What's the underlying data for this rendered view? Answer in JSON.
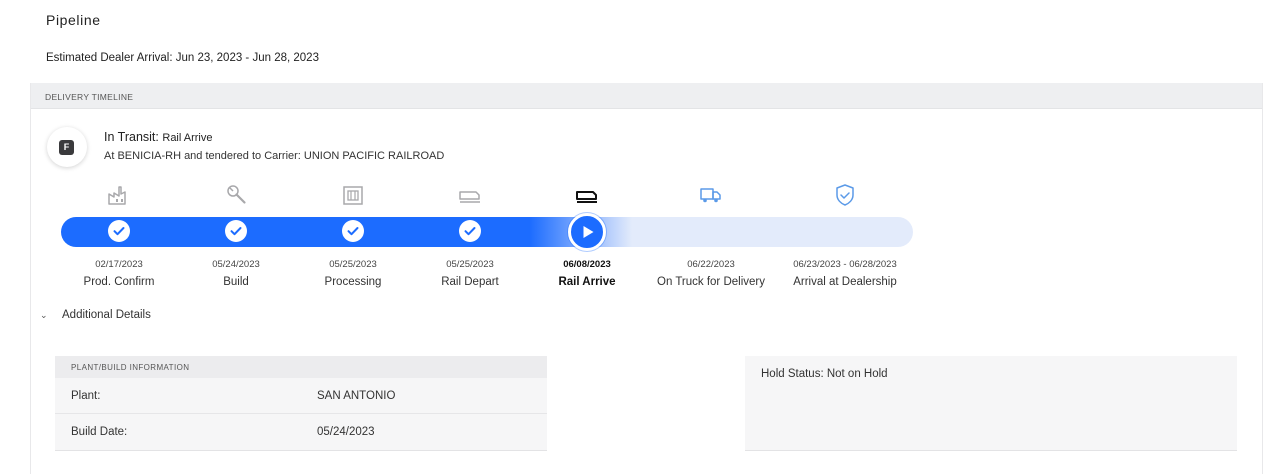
{
  "page": {
    "title": "Pipeline",
    "eta": "Estimated Dealer Arrival: Jun 23, 2023 - Jun 28, 2023"
  },
  "timeline": {
    "header": "DELIVERY TIMELINE",
    "badge": "F",
    "status_label": "In Transit:",
    "status_sub": "Rail Arrive",
    "status_detail": "At BENICIA-RH and tendered to Carrier: UNION PACIFIC RAILROAD",
    "progress_fraction": 0.62,
    "colors": {
      "active": "#1c6cff",
      "pending": "#e3ebfb",
      "done_icon": "#a8a8ab",
      "current_icon": "#111111",
      "future_icon": "#5b9ae8"
    },
    "stages": [
      {
        "date": "02/17/2023",
        "label": "Prod. Confirm",
        "icon": "factory-icon",
        "state": "done"
      },
      {
        "date": "05/24/2023",
        "label": "Build",
        "icon": "wrench-icon",
        "state": "done"
      },
      {
        "date": "05/25/2023",
        "label": "Processing",
        "icon": "gate-icon",
        "state": "done"
      },
      {
        "date": "05/25/2023",
        "label": "Rail Depart",
        "icon": "train-icon",
        "state": "done"
      },
      {
        "date": "06/08/2023",
        "label": "Rail Arrive",
        "icon": "train-icon",
        "state": "current"
      },
      {
        "date": "06/22/2023",
        "label": "On Truck for Delivery",
        "icon": "truck-icon",
        "state": "future"
      },
      {
        "date": "06/23/2023 - 06/28/2023",
        "label": "Arrival at Dealership",
        "icon": "shield-check-icon",
        "state": "future"
      }
    ]
  },
  "details": {
    "toggle_label": "Additional Details",
    "plant": {
      "header": "PLANT/BUILD INFORMATION",
      "rows": [
        {
          "key": "Plant:",
          "value": "SAN ANTONIO"
        },
        {
          "key": "Build Date:",
          "value": "05/24/2023"
        }
      ]
    },
    "hold_status": "Hold Status: Not on Hold"
  }
}
